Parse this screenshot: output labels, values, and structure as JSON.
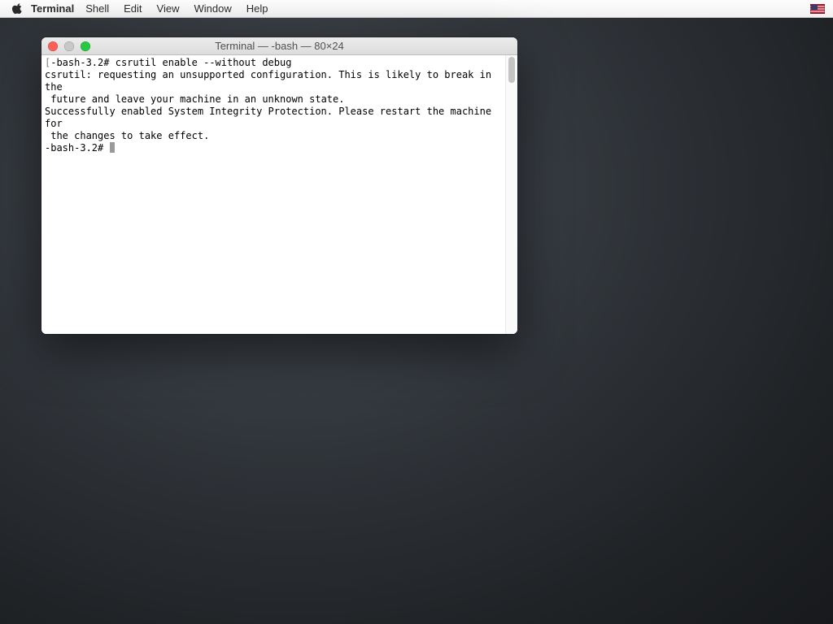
{
  "menubar": {
    "app": "Terminal",
    "items": [
      "Shell",
      "Edit",
      "View",
      "Window",
      "Help"
    ]
  },
  "window": {
    "title": "Terminal — -bash — 80×24"
  },
  "terminal": {
    "prompt1_bracket": "[",
    "prompt1": "-bash-3.2# ",
    "cmd1": "csrutil enable --without debug",
    "out_line1": "csrutil: requesting an unsupported configuration. This is likely to break in the",
    "out_line2": " future and leave your machine in an unknown state.",
    "out_line3": "Successfully enabled System Integrity Protection. Please restart the machine for",
    "out_line4": " the changes to take effect.",
    "prompt2": "-bash-3.2# "
  }
}
